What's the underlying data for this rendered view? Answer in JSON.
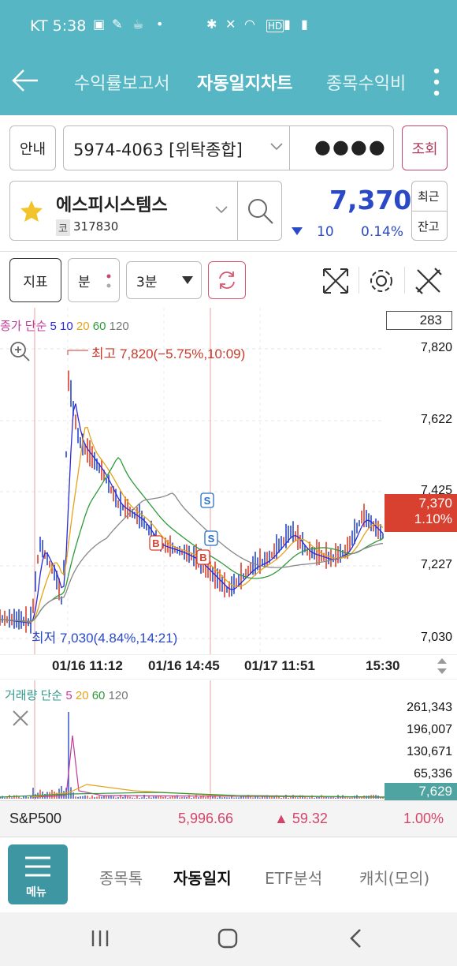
{
  "status": {
    "carrier_time": "KT 5:38"
  },
  "header": {
    "tabs": [
      "수익률보고서",
      "자동일지차트",
      "종목수익비"
    ],
    "active_tab": "자동일지차트"
  },
  "account": {
    "guide_label": "안내",
    "number": "5974-4063 [위탁종합]",
    "password_mask": "●●●●",
    "query_label": "조회"
  },
  "stock": {
    "name": "에스피시스템스",
    "market_badge": "코",
    "code": "317830",
    "price": "7,370",
    "change": "10",
    "change_pct": "0.14%",
    "recent_label": "최근",
    "balance_label": "잔고"
  },
  "toolbar": {
    "indicator_label": "지표",
    "unit_label": "분",
    "interval_value": "3분"
  },
  "price_chart": {
    "ma_prefix": "종가 단순",
    "ma": [
      {
        "label": "5",
        "color": "#2b2bd6"
      },
      {
        "label": "10",
        "color": "#2b2bd6"
      },
      {
        "label": "20",
        "color": "#e6a21a"
      },
      {
        "label": "60",
        "color": "#2f9a3a"
      },
      {
        "label": "120",
        "color": "#777777"
      }
    ],
    "visible_count": "283",
    "y_ticks": [
      "7,820",
      "7,622",
      "7,425",
      "7,227",
      "7,030"
    ],
    "high_note": "최고 7,820(−5.75%,10:09)",
    "low_note": "최저 7,030(4.84%,14:21)",
    "current_price": "7,370",
    "current_pct": "1.10%",
    "x_labels": [
      "01/16 11:12",
      "01/16 14:45",
      "01/17 11:51",
      "15:30"
    ],
    "markers": [
      "B",
      "B",
      "S",
      "S"
    ]
  },
  "volume_chart": {
    "ma_prefix": "거래량 단순",
    "ma": [
      {
        "label": "5",
        "color": "#c23a9a"
      },
      {
        "label": "20",
        "color": "#e6a21a"
      },
      {
        "label": "60",
        "color": "#2f9a3a"
      },
      {
        "label": "120",
        "color": "#777777"
      }
    ],
    "y_ticks": [
      "261,343",
      "196,007",
      "130,671",
      "65,336"
    ],
    "current_volume": "7,629"
  },
  "index_bar": {
    "name": "S&P500",
    "value": "5,996.66",
    "change": "▲ 59.32",
    "pct": "1.00%"
  },
  "bottom_nav": {
    "menu_label": "메뉴",
    "items": [
      "종목톡",
      "자동일지",
      "ETF분석",
      "캐치(모의)"
    ],
    "active_item": "자동일지"
  }
}
